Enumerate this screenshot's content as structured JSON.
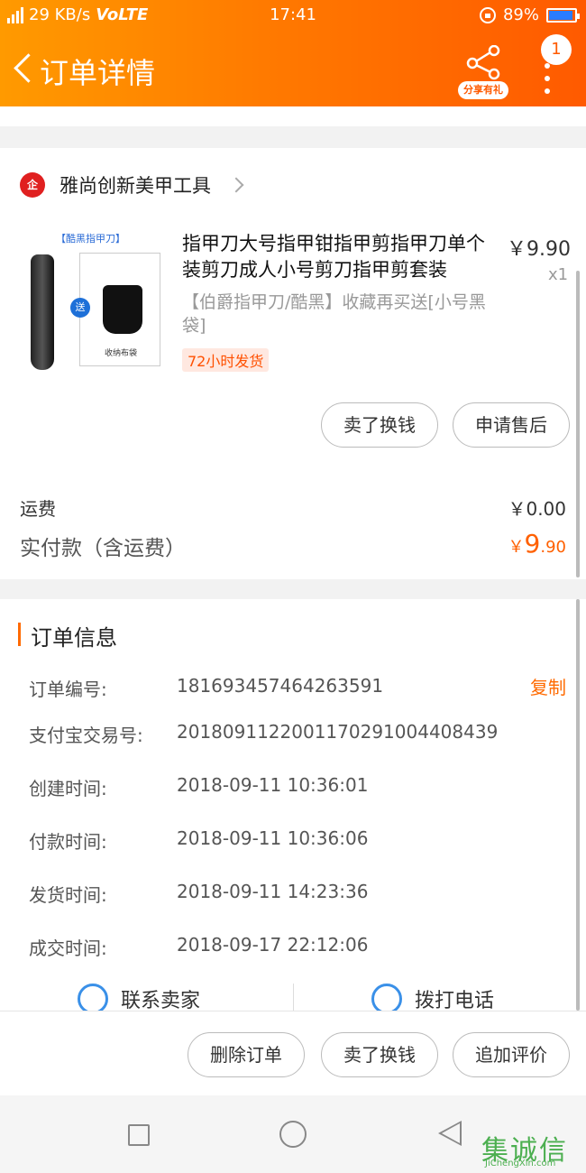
{
  "status_bar": {
    "network": "29 KB/s",
    "volte": "VoLTE",
    "time": "17:41",
    "battery": "89%"
  },
  "header": {
    "title": "订单详情",
    "share_label": "分享有礼",
    "badge_count": "1"
  },
  "shop": {
    "logo_text": "企",
    "name": "雅尚创新美甲工具"
  },
  "product": {
    "image_tag": "【酷黑指甲刀】",
    "image_send": "送",
    "image_box_label": "收纳布袋",
    "title": "指甲刀大号指甲钳指甲剪指甲刀单个装剪刀成人小号剪刀指甲剪套装",
    "price": "￥9.90",
    "qty": "x1",
    "sku": "【伯爵指甲刀/酷黑】收藏再买送[小号黑袋]",
    "ship_tag": "72小时发货",
    "btn_sell": "卖了换钱",
    "btn_aftersale": "申请售后"
  },
  "totals": {
    "shipping_label": "运费",
    "shipping_value": "￥0.00",
    "paid_label": "实付款（含运费）",
    "paid_currency": "￥",
    "paid_int": "9",
    "paid_dec": ".90"
  },
  "order_info": {
    "title": "订单信息",
    "copy_label": "复制",
    "rows": [
      {
        "label": "订单编号:",
        "value": "181693457464263591"
      },
      {
        "label": "支付宝交易号:",
        "value": "2018091122001170291004408439"
      },
      {
        "label": "创建时间:",
        "value": "2018-09-11 10:36:01"
      },
      {
        "label": "付款时间:",
        "value": "2018-09-11 10:36:06"
      },
      {
        "label": "发货时间:",
        "value": "2018-09-11 14:23:36"
      },
      {
        "label": "成交时间:",
        "value": "2018-09-17 22:12:06"
      }
    ]
  },
  "contact": {
    "seller": "联系卖家",
    "phone": "拨打电话"
  },
  "bottom_actions": {
    "delete": "删除订单",
    "sell": "卖了换钱",
    "review": "追加评价"
  },
  "watermark": {
    "big": "集诚信",
    "small": "JiChengXin.com"
  },
  "colors": {
    "accent": "#ff6a00",
    "header_start": "#ff9a00",
    "header_end": "#ff5a00"
  }
}
